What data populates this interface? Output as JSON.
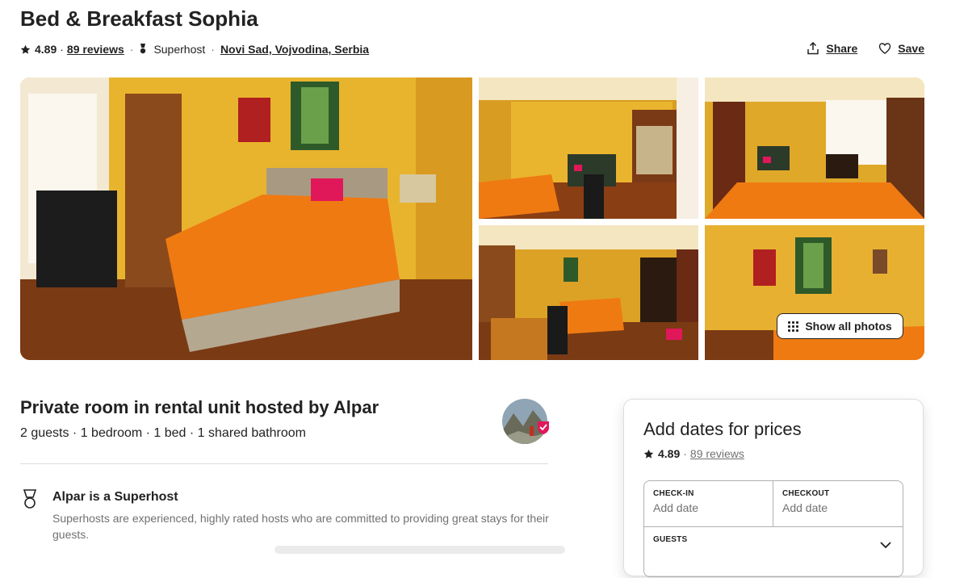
{
  "listing": {
    "title": "Bed & Breakfast Sophia",
    "rating": "4.89",
    "dot": "·",
    "reviews": "89 reviews",
    "superhost": "Superhost",
    "location": "Novi Sad, Vojvodina, Serbia"
  },
  "actions": {
    "share": "Share",
    "save": "Save"
  },
  "photos": {
    "show_all": "Show all photos"
  },
  "overview": {
    "title": "Private room in rental unit hosted by Alpar",
    "subtitle": "2 guests · 1 bedroom · 1 bed · 1 shared bathroom"
  },
  "highlight": {
    "title": "Alpar is a Superhost",
    "description": "Superhosts are experienced, highly rated hosts who are committed to providing great stays for their guests."
  },
  "booking": {
    "title": "Add dates for prices",
    "rating": "4.89",
    "dot": "·",
    "reviews": "89 reviews",
    "checkin_label": "CHECK-IN",
    "checkin_value": "Add date",
    "checkout_label": "CHECKOUT",
    "checkout_value": "Add date",
    "guests_label": "GUESTS"
  },
  "icons": [
    "star-icon",
    "superhost-medal-icon",
    "share-icon",
    "heart-icon",
    "grid-dots-icon",
    "chevron-down-icon"
  ],
  "colors": {
    "text": "#222222",
    "muted": "#717171",
    "border": "#dddddd",
    "wall": "#e8b32a",
    "blanket": "#f07a12"
  }
}
